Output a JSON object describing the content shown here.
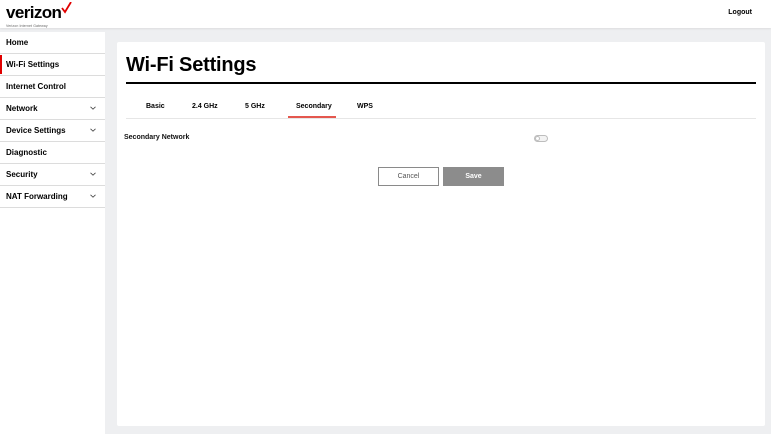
{
  "header": {
    "brand": "verizon",
    "tagline": "Verizon Internet Gateway",
    "logout_label": "Logout",
    "brand_accent": "#e00000"
  },
  "sidebar": {
    "items": [
      {
        "label": "Home",
        "active": false,
        "has_submenu": false
      },
      {
        "label": "Wi-Fi Settings",
        "active": true,
        "has_submenu": false
      },
      {
        "label": "Internet Control",
        "active": false,
        "has_submenu": false
      },
      {
        "label": "Network",
        "active": false,
        "has_submenu": true
      },
      {
        "label": "Device Settings",
        "active": false,
        "has_submenu": true
      },
      {
        "label": "Diagnostic",
        "active": false,
        "has_submenu": false
      },
      {
        "label": "Security",
        "active": false,
        "has_submenu": true
      },
      {
        "label": "NAT Forwarding",
        "active": false,
        "has_submenu": true
      }
    ]
  },
  "main": {
    "title": "Wi-Fi Settings",
    "tabs": [
      {
        "label": "Basic",
        "active": false
      },
      {
        "label": "2.4 GHz",
        "active": false
      },
      {
        "label": "5 GHz",
        "active": false
      },
      {
        "label": "Secondary",
        "active": true
      },
      {
        "label": "WPS",
        "active": false
      }
    ],
    "active_tab_color": "#e4574e",
    "secondary_network": {
      "label": "Secondary Network",
      "enabled": false
    },
    "buttons": {
      "cancel_label": "Cancel",
      "save_label": "Save"
    }
  }
}
